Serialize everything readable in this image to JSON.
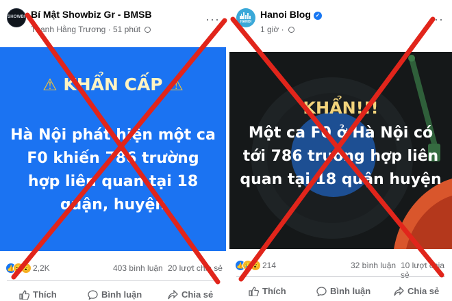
{
  "left_post": {
    "page_name": "Bí Mật Showbiz Gr - BMSB",
    "author": "Thanh Hằng Trương",
    "time": "51 phút",
    "avatar_text": "SHOWBIZ",
    "card": {
      "urgent": "KHẨN CẤP",
      "body": "Hà Nội phát hiện một ca F0 khiến 786 trường hợp liên quan tại 18 quận, huyện"
    },
    "reaction_count": "2,2K",
    "comments": "403 bình luận",
    "shares": "20 lượt chia sẻ",
    "actions": [
      "Thích",
      "Bình luận",
      "Chia sẻ"
    ]
  },
  "right_post": {
    "page_name": "Hanoi Blog",
    "time": "1 giờ",
    "avatar_text": "HANOI",
    "card": {
      "urgent": "KHẨN!!!",
      "body": "Một ca F0 ở Hà Nội có tới 786 trường hợp liên quan tại 18 quận huyện"
    },
    "reaction_count": "214",
    "comments": "32 bình luận",
    "shares": "10 lượt chia sẻ",
    "actions": [
      "Thích",
      "Bình luận",
      "Chia sẻ"
    ]
  },
  "colors": {
    "left_card_bg": "#1b73f2",
    "right_card_bg": "#151819",
    "cross": "#e1251b"
  },
  "icons": [
    "more-icon",
    "globe-icon",
    "verified-icon",
    "like-icon",
    "comment-icon",
    "share-icon",
    "warning-icon"
  ]
}
